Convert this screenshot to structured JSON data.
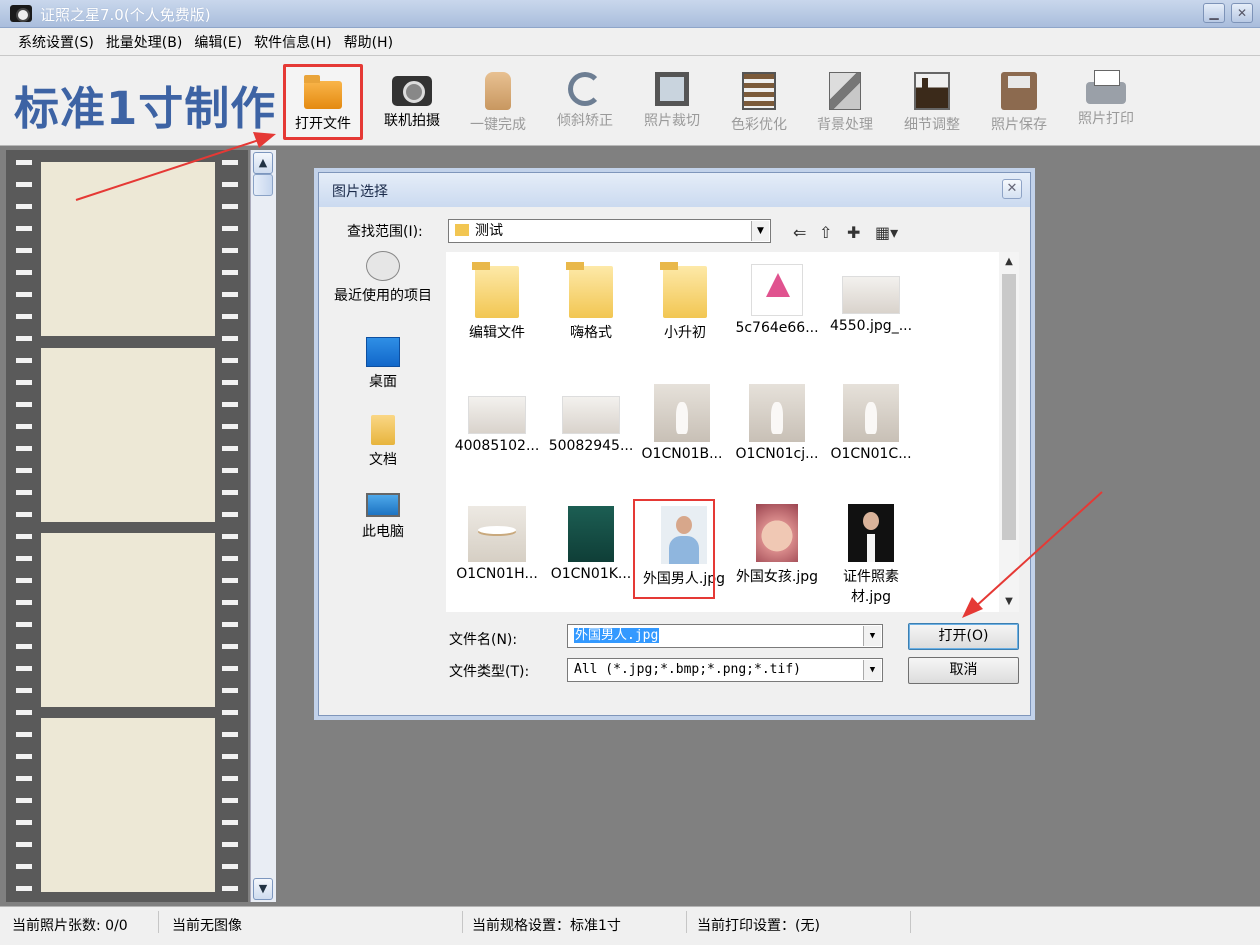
{
  "window": {
    "title": "证照之星7.0(个人免费版)",
    "minimize_glyph": "▁",
    "close_glyph": "✕"
  },
  "menu": [
    "系统设置(S)",
    "批量处理(B)",
    "编辑(E)",
    "软件信息(H)",
    "帮助(H)"
  ],
  "toolbar": {
    "brand": "标准1寸制作",
    "tools": [
      {
        "label": "打开文件",
        "icon": "folder-open-icon",
        "enabled": true,
        "highlighted": true
      },
      {
        "label": "联机拍摄",
        "icon": "camera-icon",
        "enabled": true
      },
      {
        "label": "一键完成",
        "icon": "hand-pointer-icon",
        "enabled": false
      },
      {
        "label": "倾斜矫正",
        "icon": "rotate-icon",
        "enabled": false
      },
      {
        "label": "照片裁切",
        "icon": "crop-icon",
        "enabled": false
      },
      {
        "label": "色彩优化",
        "icon": "color-adjust-icon",
        "enabled": false
      },
      {
        "label": "背景处理",
        "icon": "brush-icon",
        "enabled": false
      },
      {
        "label": "细节调整",
        "icon": "histogram-icon",
        "enabled": false
      },
      {
        "label": "照片保存",
        "icon": "save-icon",
        "enabled": false
      },
      {
        "label": "照片打印",
        "icon": "printer-icon",
        "enabled": false
      }
    ]
  },
  "dialog": {
    "title": "图片选择",
    "look_in_label": "查找范围(I):",
    "look_in_value": "测试",
    "places": [
      {
        "label": "最近使用的项目",
        "icon": "recent-items-icon"
      },
      {
        "label": "桌面",
        "icon": "desktop-icon"
      },
      {
        "label": "文档",
        "icon": "documents-icon"
      },
      {
        "label": "此电脑",
        "icon": "this-pc-icon"
      }
    ],
    "files": [
      {
        "name": "编辑文件",
        "kind": "folder"
      },
      {
        "name": "嗨格式",
        "kind": "folder"
      },
      {
        "name": "小升初",
        "kind": "folder"
      },
      {
        "name": "5c764e66...",
        "kind": "logo"
      },
      {
        "name": "4550.jpg_...",
        "kind": "wide"
      },
      {
        "name": "40085102...",
        "kind": "wide"
      },
      {
        "name": "50082945...",
        "kind": "wide"
      },
      {
        "name": "O1CN01B...",
        "kind": "vase"
      },
      {
        "name": "O1CN01cj...",
        "kind": "vase"
      },
      {
        "name": "O1CN01C...",
        "kind": "vase"
      },
      {
        "name": "O1CN01H...",
        "kind": "table"
      },
      {
        "name": "O1CN01K...",
        "kind": "green"
      },
      {
        "name": "外国男人.jpg",
        "kind": "man",
        "selected": true
      },
      {
        "name": "外国女孩.jpg",
        "kind": "girl"
      },
      {
        "name": "证件照素材.jpg",
        "kind": "suit"
      }
    ],
    "filename_label": "文件名(N):",
    "filename_value": "外国男人.jpg",
    "filetype_label": "文件类型(T):",
    "filetype_value": "All (*.jpg;*.bmp;*.png;*.tif)",
    "open_button": "打开(O)",
    "cancel_button": "取消"
  },
  "status": {
    "photo_count": "当前照片张数: 0/0",
    "image_status": "当前无图像",
    "spec": "当前规格设置：标准1寸",
    "print": "当前打印设置：(无)"
  },
  "colors": {
    "brand": "#3d63a4",
    "highlight": "#e53935",
    "workspace": "#808080"
  }
}
